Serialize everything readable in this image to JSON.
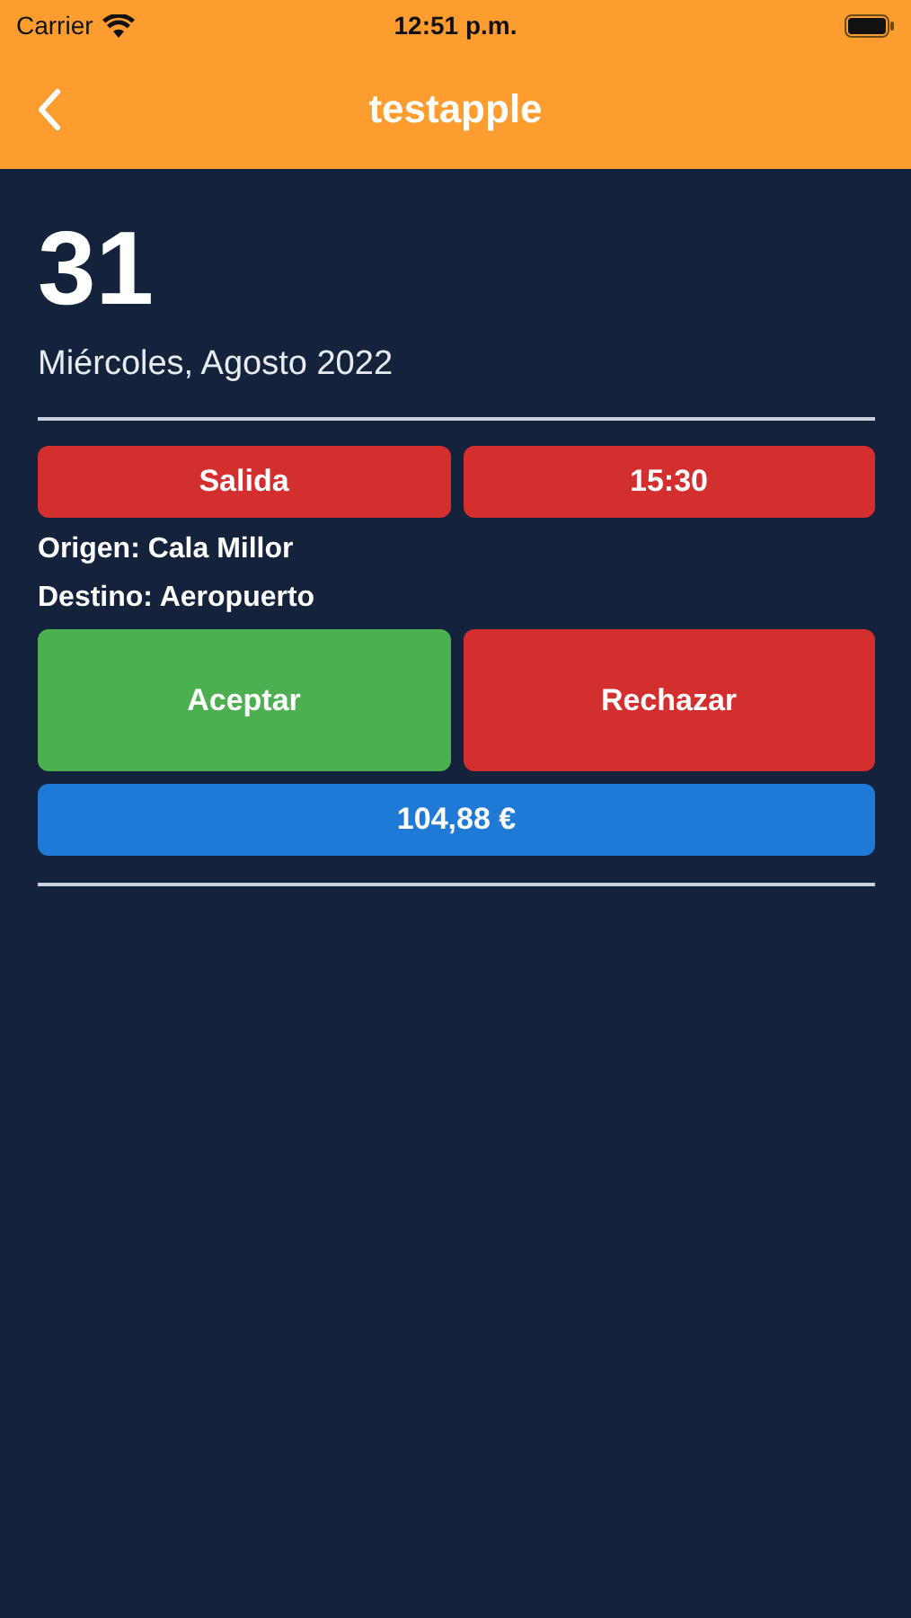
{
  "status_bar": {
    "carrier": "Carrier",
    "time": "12:51 p.m."
  },
  "nav": {
    "title": "testapple"
  },
  "date": {
    "day": "31",
    "subtitle": "Miércoles, Agosto 2022"
  },
  "trip": {
    "tags": [
      "Salida",
      "15:30"
    ],
    "origin": "Origen: Cala Millor",
    "destination": "Destino: Aeropuerto",
    "actions": [
      {
        "label": "Aceptar",
        "kind": "accept"
      },
      {
        "label": "Rechazar",
        "kind": "reject"
      }
    ],
    "price": "104,88 €"
  }
}
